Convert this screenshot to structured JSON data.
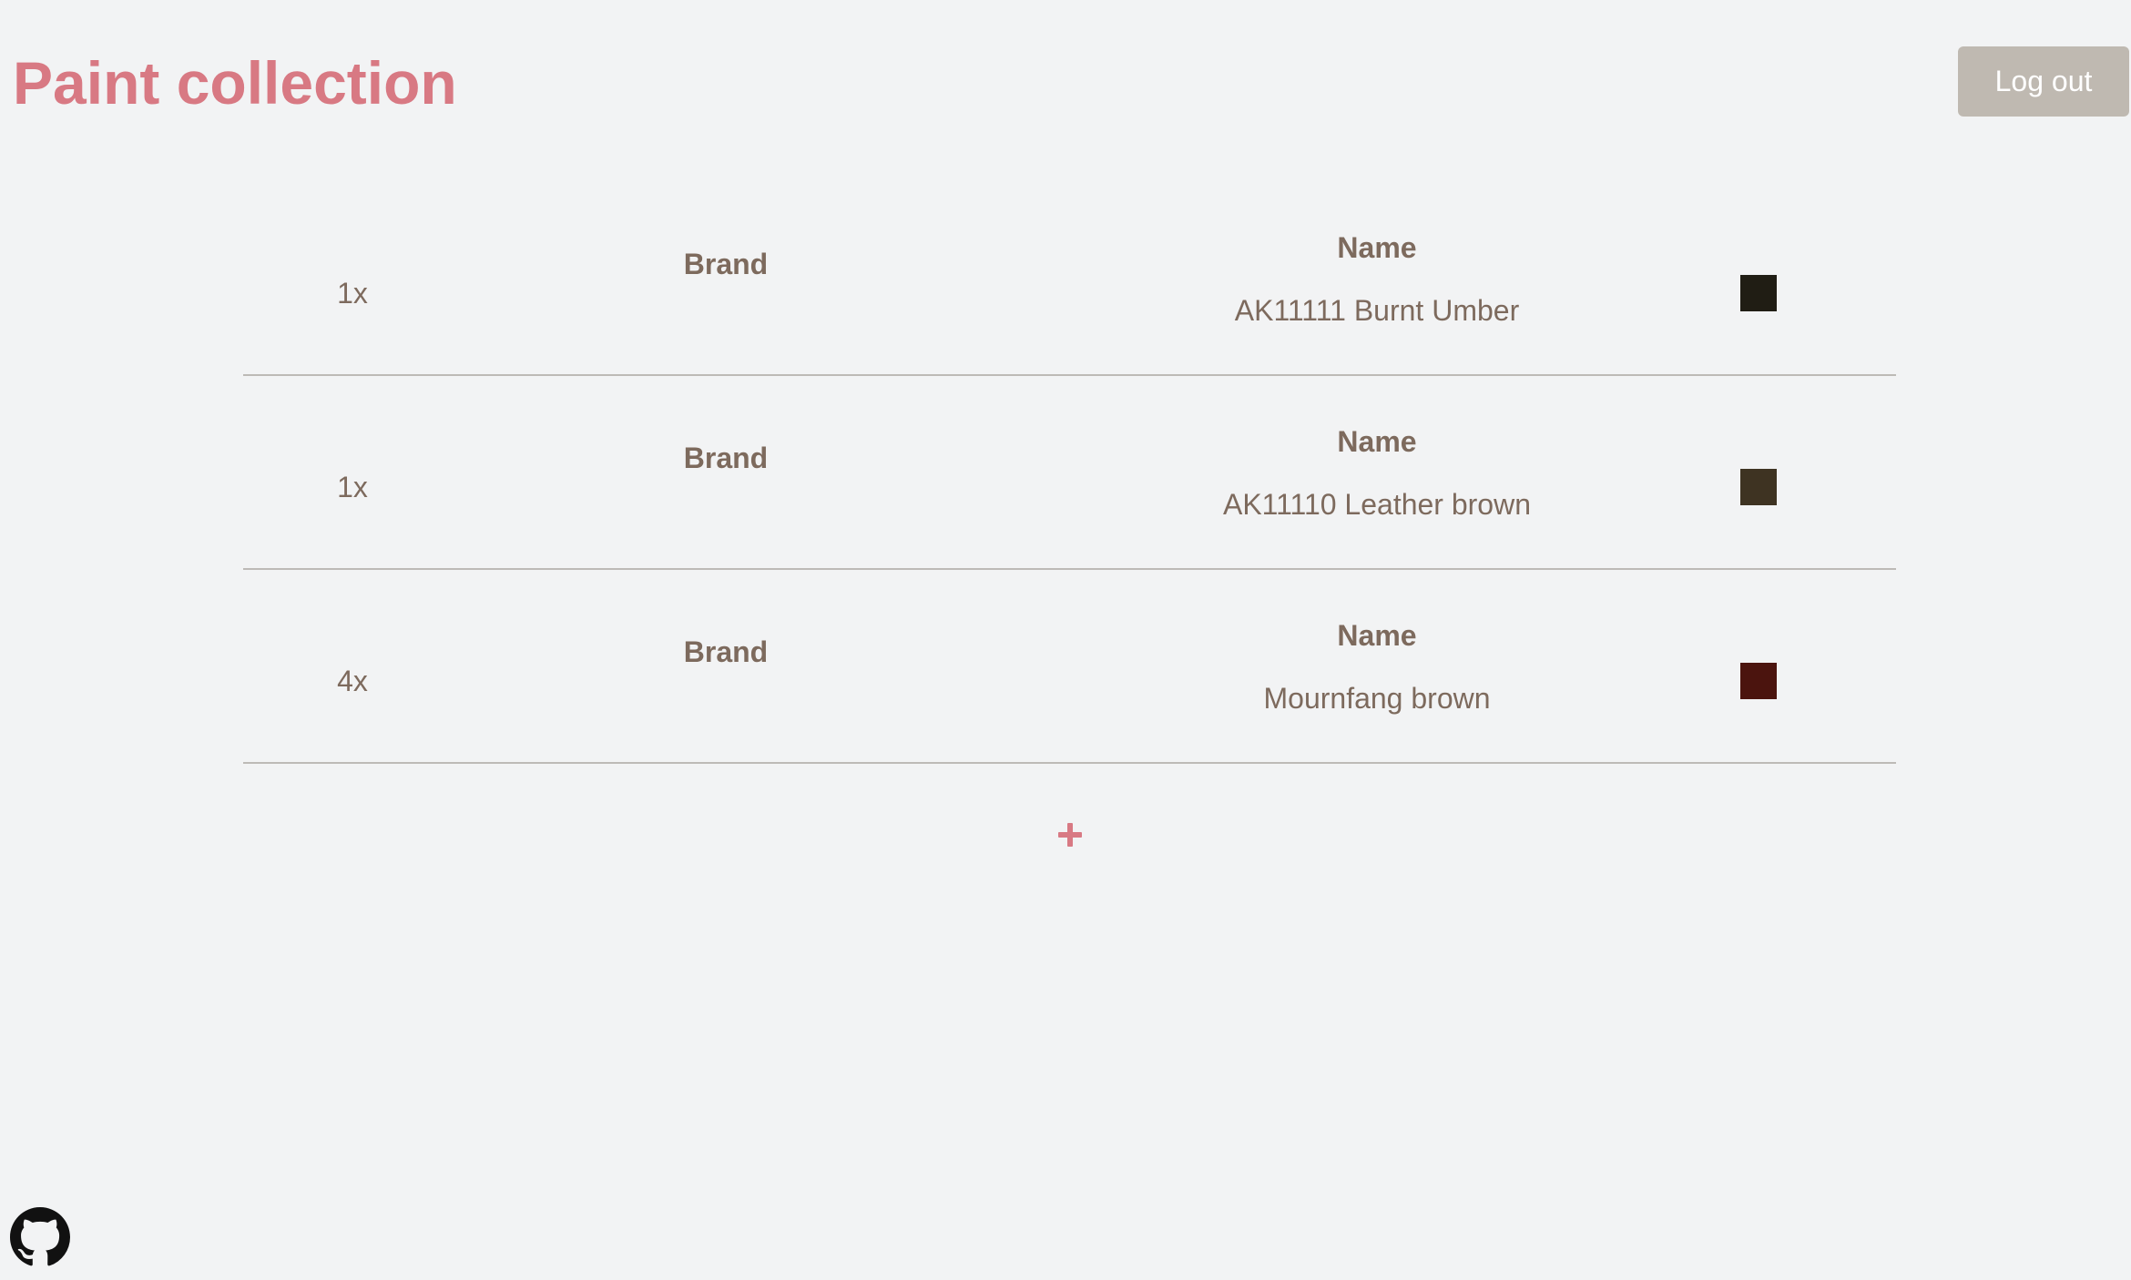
{
  "header": {
    "title": "Paint collection",
    "logout_label": "Log out"
  },
  "paints": [
    {
      "quantity": "1x",
      "brand_label": "Brand",
      "name_label": "Name",
      "name": "AK11111 Burnt Umber",
      "color": "#201d14"
    },
    {
      "quantity": "1x",
      "brand_label": "Brand",
      "name_label": "Name",
      "name": "AK11110 Leather brown",
      "color": "#3e3322"
    },
    {
      "quantity": "4x",
      "brand_label": "Brand",
      "name_label": "Name",
      "name": "Mournfang brown",
      "color": "#4b140e"
    }
  ],
  "actions": {
    "add_icon": "plus-icon"
  },
  "footer": {
    "icon": "github-icon"
  },
  "theme": {
    "accent": "#d87983",
    "text": "#7d6a5d",
    "background": "#f2f3f4",
    "button": "#bfb9b1"
  }
}
